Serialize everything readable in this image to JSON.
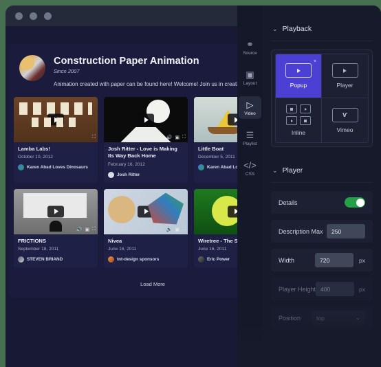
{
  "window": {
    "traffic_lights": [
      "minimize",
      "maximize",
      "close"
    ]
  },
  "channel": {
    "title": "Construction Paper Animation",
    "since": "Since 2007",
    "description": "Animation created with paper can be found here! Welcome! Join us in creating arts and crafts!",
    "avatar_name": "channel-avatar"
  },
  "videos": [
    {
      "title": "Lamba Labs!",
      "date": "October 10, 2012",
      "author": "Karen Abad Loves Dinosaurs"
    },
    {
      "title": "Josh Ritter - Love is Making Its Way Back Home",
      "date": "February 16, 2012",
      "author": "Josh Ritter"
    },
    {
      "title": "Little Boat",
      "date": "December 5, 2011",
      "author": "Karen Abad Loves Di"
    },
    {
      "title": "FRICTIONS",
      "date": "September 18, 2011",
      "author": "STEVEN BRIAND"
    },
    {
      "title": "Nivea",
      "date": "June 16, 2011",
      "author": "tnt-design sponsors"
    },
    {
      "title": "Wiretree - The Shore",
      "date": "June 16, 2011",
      "author": "Eric Power"
    }
  ],
  "load_more_label": "Load More",
  "panel": {
    "nav": [
      {
        "label": "Source",
        "icon": "link-icon",
        "glyph": "⚭",
        "active": false
      },
      {
        "label": "Layout",
        "icon": "layout-icon",
        "glyph": "▣",
        "active": false
      },
      {
        "label": "Video",
        "icon": "play-icon",
        "glyph": "▷",
        "active": true
      },
      {
        "label": "Playlist",
        "icon": "list-icon",
        "glyph": "☰",
        "active": false
      },
      {
        "label": "CSS",
        "icon": "code-icon",
        "glyph": "</>",
        "active": false
      }
    ],
    "playback": {
      "heading": "Playback",
      "chevron": "⌄",
      "selected": "Popup",
      "modes": [
        {
          "label": "Popup",
          "icon": "popup-screen-icon",
          "close_glyph": "×"
        },
        {
          "label": "Player",
          "icon": "player-screen-icon"
        },
        {
          "label": "Inline",
          "icon": "inline-grid-icon"
        },
        {
          "label": "Vimeo",
          "icon": "vimeo-icon",
          "glyph": "ѵ"
        }
      ]
    },
    "player": {
      "heading": "Player",
      "chevron": "⌄",
      "settings": [
        {
          "label": "Details",
          "type": "toggle",
          "value": "on"
        },
        {
          "label": "Description Max",
          "type": "input",
          "value": "250",
          "unit": ""
        },
        {
          "label": "Width",
          "type": "input",
          "value": "720",
          "unit": "px"
        },
        {
          "label": "Player Height",
          "type": "input",
          "value": "400",
          "unit": "px"
        },
        {
          "label": "Position",
          "type": "select",
          "value": "top",
          "chevron": "⌄"
        }
      ]
    }
  },
  "colors": {
    "accent_purple": "#4b3fd4",
    "toggle_green": "#24a148",
    "desktop_green": "#46704f",
    "panel_bg": "#161a2b",
    "window_navy": "#1b1c3d"
  }
}
